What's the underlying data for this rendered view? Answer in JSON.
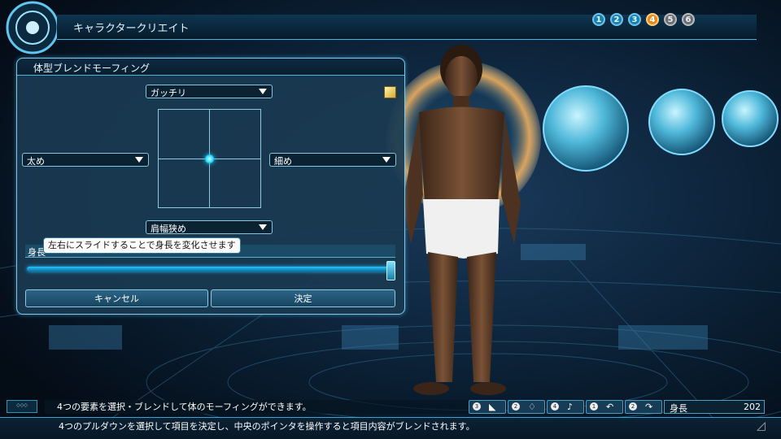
{
  "header": {
    "title": "キャラクタークリエイト",
    "steps": [
      {
        "label": "1",
        "state": "done"
      },
      {
        "label": "2",
        "state": "done"
      },
      {
        "label": "3",
        "state": "done"
      },
      {
        "label": "4",
        "state": "active"
      },
      {
        "label": "5",
        "state": "future"
      },
      {
        "label": "6",
        "state": "future"
      }
    ]
  },
  "panel": {
    "title": "体型ブレンドモーフィング",
    "top_dropdown": "ガッチリ",
    "left_dropdown": "太め",
    "right_dropdown": "細め",
    "bottom_dropdown": "肩幅狭め",
    "height_label": "身長",
    "tooltip": "左右にスライドすることで身長を変化させます",
    "height_slider_value": 1.0,
    "blend_pointer": {
      "x": 0.0,
      "y": 0.0
    },
    "cancel_label": "キャンセル",
    "confirm_label": "決定"
  },
  "footer": {
    "help_line_1": "4つの要素を選択・ブレンドして体のモーフィングができます。",
    "help_line_2": "4つのプルダウンを選択して項目を決定し、中央のポインタを操作すると項目内容がブレンドされます。",
    "buttons": [
      {
        "num": "3",
        "icon": "camera-icon",
        "glyph": "◣"
      },
      {
        "num": "2",
        "icon": "shirt-icon",
        "glyph": "♢"
      },
      {
        "num": "4",
        "icon": "microphone-icon",
        "glyph": "♪"
      },
      {
        "num": "1",
        "icon": "undo-icon",
        "glyph": "↶"
      },
      {
        "num": "2",
        "icon": "redo-icon",
        "glyph": "↷"
      }
    ],
    "status_label": "身長",
    "status_value": "202"
  },
  "colors": {
    "accent": "#3fb6e6",
    "step_active": "#e58a22",
    "panel_bg": "#1a3a52"
  }
}
